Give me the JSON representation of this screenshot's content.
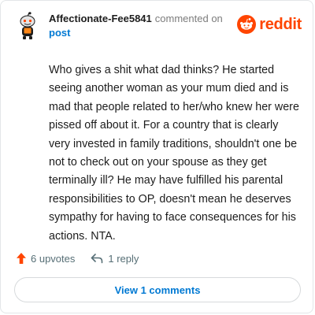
{
  "comment": {
    "author": "Affectionate-Fee5841",
    "action_text": "commented on",
    "target": "post",
    "body": "Who gives a shit what dad thinks? He started seeing another woman as your mum died and is mad that people related to her/who knew her were pissed off about it. For a country that is clearly very invested in family traditions, shouldn't one be not to check out on your spouse as they get terminally ill? He may have fulfilled his parental responsibilities to OP, doesn't mean he deserves sympathy for having to face consequences for his actions. NTA."
  },
  "brand": {
    "wordmark": "reddit",
    "icon": "reddit-snoo-icon",
    "color": "#ff4500"
  },
  "actions": {
    "upvotes_label": "6 upvotes",
    "upvote_icon": "upvote-arrow-icon",
    "upvote_color": "#ff4500",
    "reply_label": "1 reply",
    "reply_icon": "reply-arrow-icon"
  },
  "footer": {
    "view_comments_label": "View 1 comments"
  },
  "colors": {
    "link": "#0079d3",
    "muted": "#7c7c7c"
  }
}
